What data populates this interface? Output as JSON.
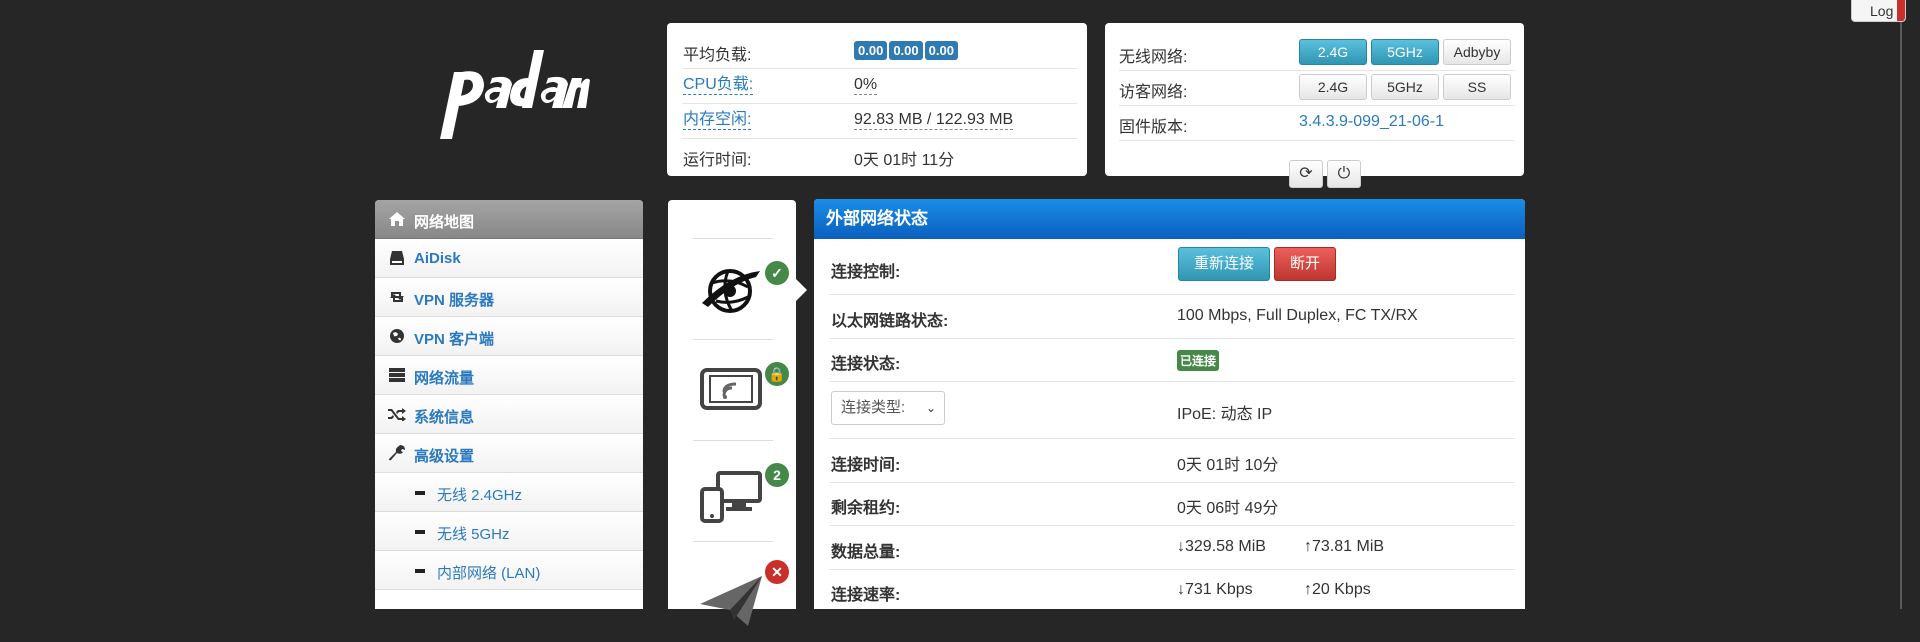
{
  "logout": {
    "label": "Log"
  },
  "logo": {
    "alt": "padavan-logo"
  },
  "status": {
    "load_label": "平均负载:",
    "load_values": [
      "0.00",
      "0.00",
      "0.00"
    ],
    "cpu_label": "CPU负载:",
    "cpu_value": "0%",
    "mem_label": "内存空闲:",
    "mem_value": "92.83 MB / 122.93 MB",
    "uptime_label": "运行时间:",
    "uptime_value": "0天 01时 11分"
  },
  "wifi": {
    "wireless_label": "无线网络:",
    "wireless_buttons": [
      "2.4G",
      "5GHz",
      "Adbyby"
    ],
    "guest_label": "访客网络:",
    "guest_buttons": [
      "2.4G",
      "5GHz",
      "SS"
    ],
    "firmware_label": "固件版本:",
    "firmware_value": "3.4.3.9-099_21-06-1"
  },
  "menu": {
    "items": [
      {
        "label": "网络地图",
        "icon": "home-icon",
        "active": true
      },
      {
        "label": "AiDisk",
        "icon": "hdd-icon"
      },
      {
        "label": "VPN 服务器",
        "icon": "retweet-icon"
      },
      {
        "label": "VPN 客户端",
        "icon": "globe-icon"
      },
      {
        "label": "网络流量",
        "icon": "tasks-icon"
      },
      {
        "label": "系统信息",
        "icon": "random-icon"
      },
      {
        "label": "高级设置",
        "icon": "wrench-icon"
      }
    ],
    "sub_items": [
      "无线 2.4GHz",
      "无线 5GHz",
      "内部网络 (LAN)"
    ]
  },
  "icons": {
    "internet_status": "check",
    "wifi_status": "lock",
    "clients_count": "2",
    "vpn_status": "x"
  },
  "wan": {
    "title": "外部网络状态",
    "control_label": "连接控制:",
    "reconnect_btn": "重新连接",
    "disconnect_btn": "断开",
    "link_label": "以太网链路状态:",
    "link_value": "100 Mbps, Full Duplex, FC TX/RX",
    "conn_label": "连接状态:",
    "conn_value": "已连接",
    "type_select": "连接类型:",
    "type_value": "IPoE: 动态 IP",
    "time_label": "连接时间:",
    "time_value": "0天 01时 10分",
    "lease_label": "剩余租约:",
    "lease_value": "0天 06时 49分",
    "total_label": "数据总量:",
    "total_down": "329.58 MiB",
    "total_up": "73.81 MiB",
    "rate_label": "连接速率:",
    "rate_down": "731 Kbps",
    "rate_up": "20 Kbps"
  },
  "colors": {
    "header_blue": "#0b5fbf",
    "link_blue": "#2b7ac0",
    "badge_blue": "#2f7ab3",
    "success_green": "#468847",
    "danger_red": "#bd362f"
  }
}
